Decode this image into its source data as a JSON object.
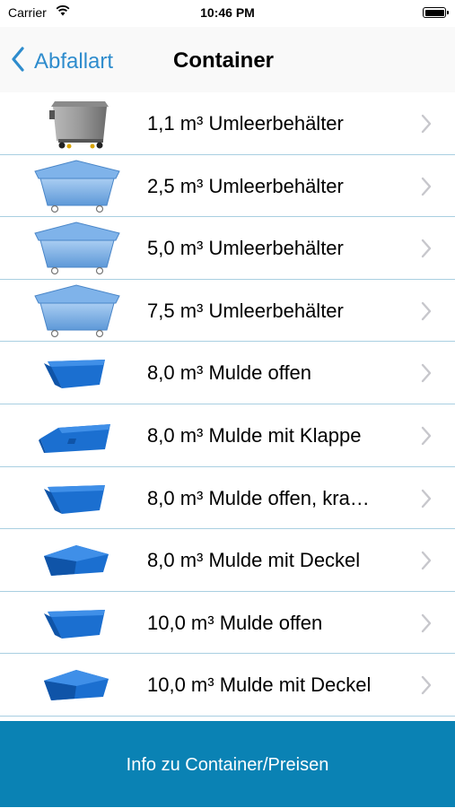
{
  "status_bar": {
    "carrier": "Carrier",
    "time": "10:46 PM"
  },
  "nav": {
    "back_label": "Abfallart",
    "title": "Container"
  },
  "accent_color": "#2e8ccd",
  "items": [
    {
      "label": "1,1 m³ Umleerbehälter",
      "icon": "gray-wheelie-bin-icon"
    },
    {
      "label": "2,5 m³ Umleerbehälter",
      "icon": "blue-bin-icon"
    },
    {
      "label": "5,0 m³ Umleerbehälter",
      "icon": "blue-bin-icon"
    },
    {
      "label": "7,5 m³ Umleerbehälter",
      "icon": "blue-bin-icon"
    },
    {
      "label": "8,0 m³ Mulde offen",
      "icon": "skip-container-icon"
    },
    {
      "label": "8,0 m³ Mulde mit Klappe",
      "icon": "skip-flap-icon"
    },
    {
      "label": "8,0 m³ Mulde offen, kra…",
      "icon": "skip-container-icon"
    },
    {
      "label": "8,0 m³ Mulde mit Deckel",
      "icon": "skip-lid-icon"
    },
    {
      "label": "10,0 m³ Mulde offen",
      "icon": "skip-container-icon"
    },
    {
      "label": "10,0 m³ Mulde mit Deckel",
      "icon": "skip-lid-icon"
    }
  ],
  "footer": {
    "info_label": "Info zu Container/Preisen",
    "color": "#0a82b4"
  }
}
